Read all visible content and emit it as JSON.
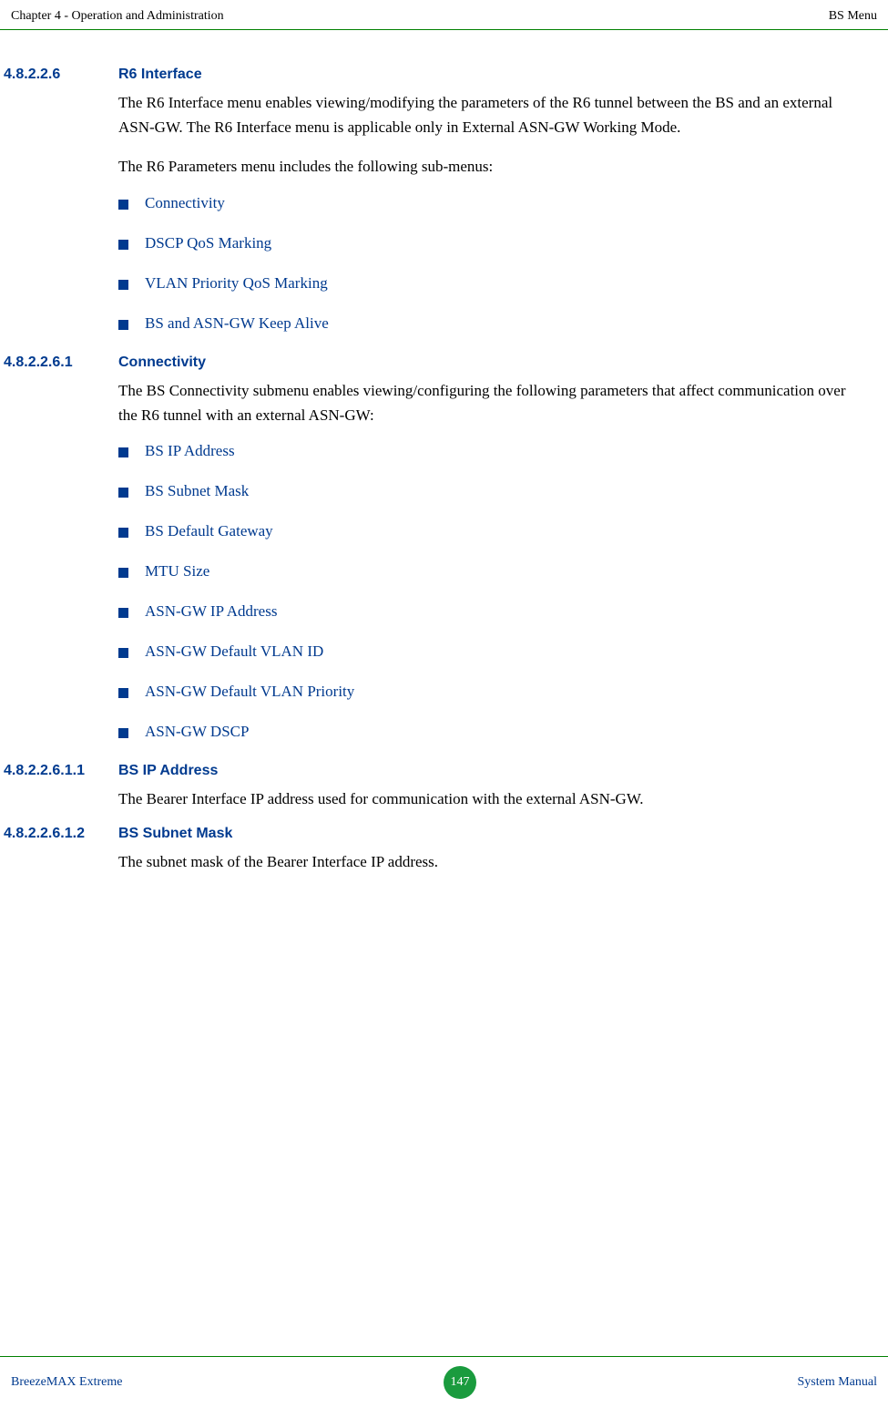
{
  "header": {
    "left": "Chapter 4 - Operation and Administration",
    "right": "BS Menu"
  },
  "sections": {
    "s1": {
      "num": "4.8.2.2.6",
      "title": "R6 Interface",
      "para1": "The R6 Interface menu enables viewing/modifying the parameters of the R6 tunnel between the BS and an external ASN-GW. The R6 Interface menu is applicable only in External ASN-GW Working Mode.",
      "para2": "The R6 Parameters menu includes the following sub-menus:",
      "bullets": [
        "Connectivity",
        "DSCP QoS Marking",
        "VLAN Priority QoS Marking",
        "BS and ASN-GW Keep Alive"
      ]
    },
    "s2": {
      "num": "4.8.2.2.6.1",
      "title": "Connectivity",
      "para1": "The BS Connectivity submenu enables viewing/configuring the following parameters that affect communication over the R6 tunnel with an external ASN-GW:",
      "bullets": [
        "BS IP Address",
        "BS Subnet Mask",
        "BS Default Gateway",
        "MTU Size",
        "ASN-GW IP Address",
        "ASN-GW Default VLAN ID",
        "ASN-GW Default VLAN Priority",
        "ASN-GW DSCP"
      ]
    },
    "s3": {
      "num": "4.8.2.2.6.1.1",
      "title": "BS IP Address",
      "para1": "The Bearer Interface IP address used for communication with the external ASN-GW."
    },
    "s4": {
      "num": "4.8.2.2.6.1.2",
      "title": "BS Subnet Mask",
      "para1": "The subnet mask of the Bearer Interface IP address."
    }
  },
  "footer": {
    "left": "BreezeMAX Extreme",
    "page": "147",
    "right": "System Manual"
  }
}
